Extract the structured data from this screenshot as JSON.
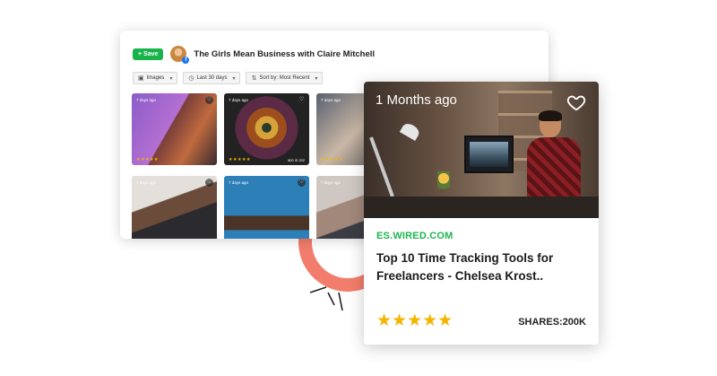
{
  "panel": {
    "save_label": "+ Save",
    "title": "The Girls Mean Business with Claire Mitchell",
    "filters": [
      {
        "icon": "image-icon",
        "label": "Images"
      },
      {
        "icon": "clock-icon",
        "label": "Last 30 days"
      },
      {
        "icon": "sort-icon",
        "label": "Sort by: Most Recent"
      }
    ],
    "cards": [
      {
        "age": "7 days ago",
        "stars": "★★★★★",
        "meta": ""
      },
      {
        "age": "7 days ago",
        "stars": "★★★★★",
        "meta": "800 ⊘ 202"
      },
      {
        "age": "7 days ago",
        "stars": "★★★★★",
        "meta": ""
      },
      {
        "age": "7 days ago",
        "stars": "",
        "meta": ""
      },
      {
        "age": "7 days ago",
        "stars": "",
        "meta": ""
      },
      {
        "age": "7 days ago",
        "stars": "",
        "meta": ""
      }
    ]
  },
  "article": {
    "age": "1 Months ago",
    "source": "ES.WIRED.COM",
    "headline": "Top 10 Time Tracking Tools for Freelancers - Chelsea Krost..",
    "rating": "★★★★★",
    "shares": "SHARES:200K"
  },
  "colors": {
    "accent_green": "#1fb650",
    "save_green": "#18b34a",
    "star": "#f5b400",
    "deco_coral": "#f27d6c"
  }
}
